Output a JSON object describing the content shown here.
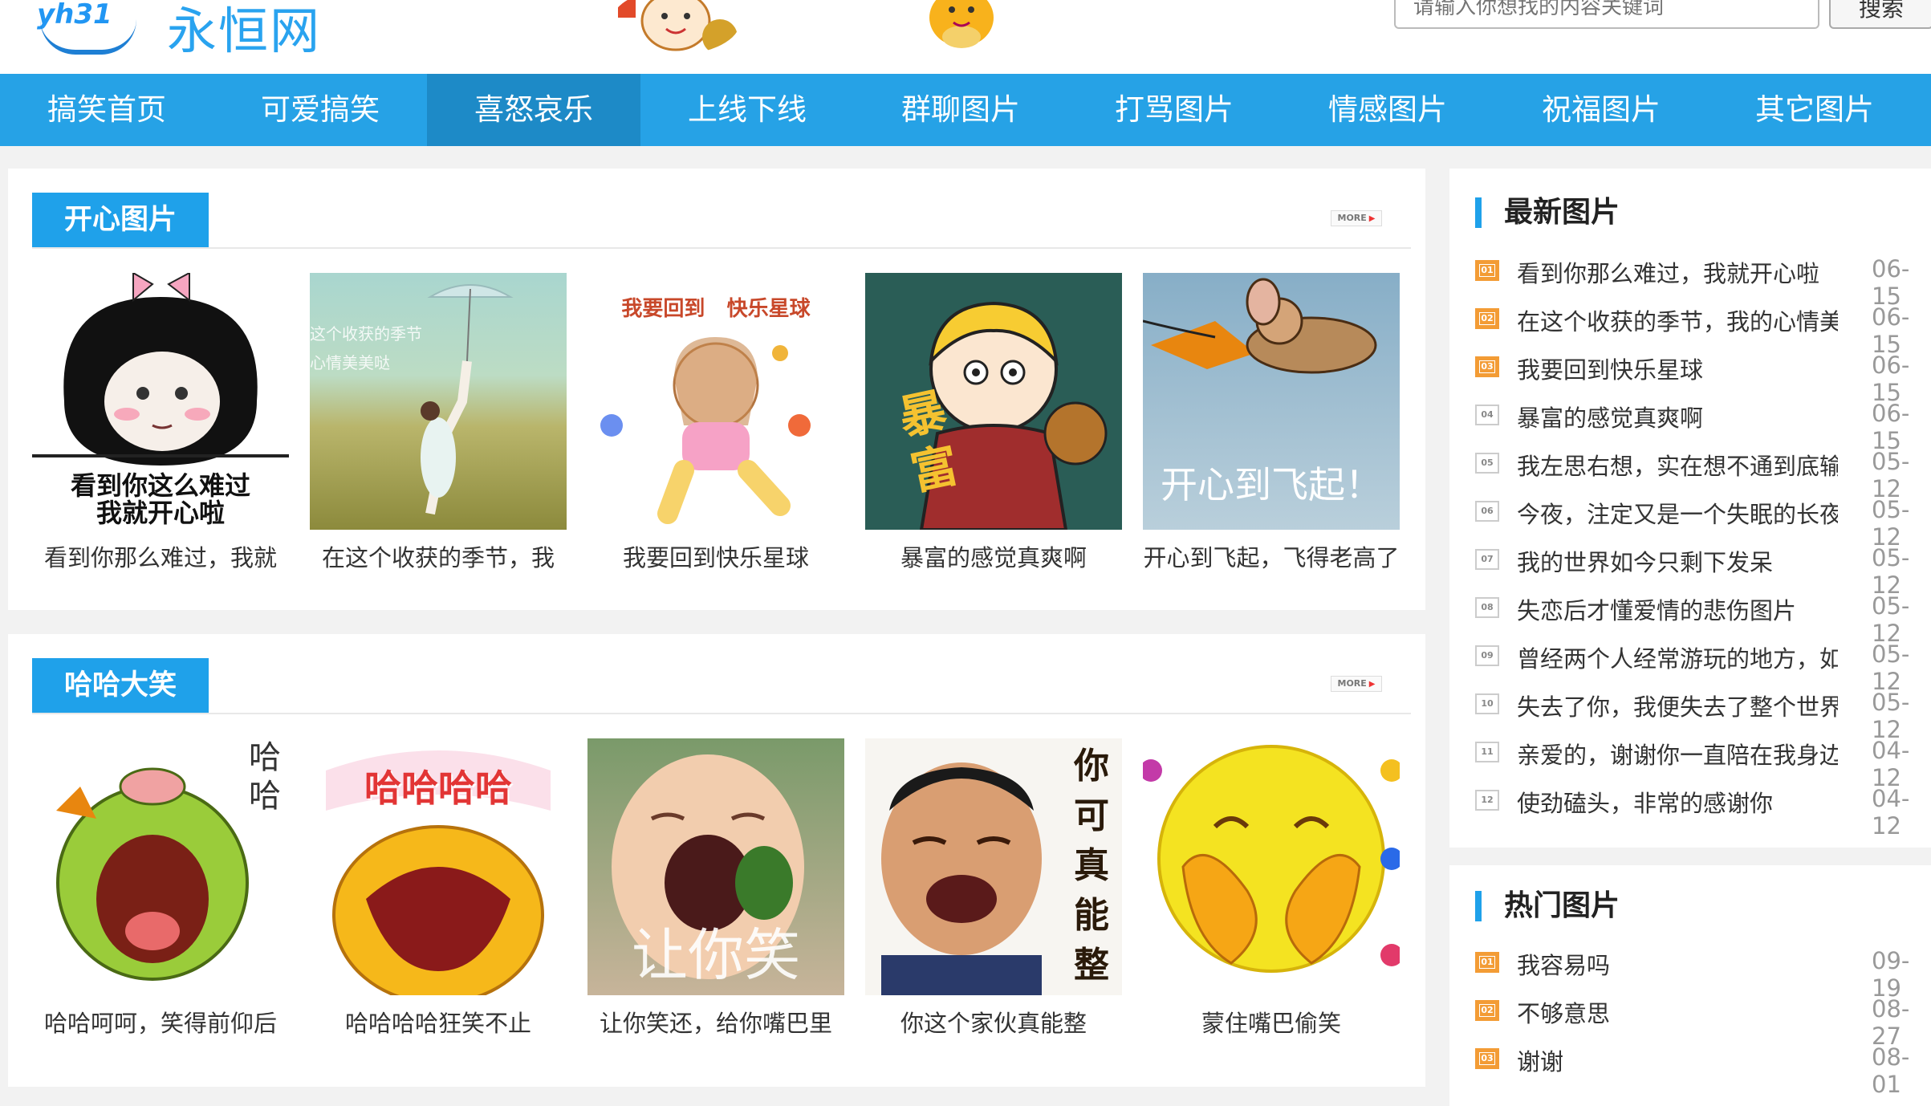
{
  "header": {
    "logo_text": "yh31",
    "logo_cn": "永恒网",
    "search_placeholder": "请输入你想找的内容关键词",
    "search_button": "搜索"
  },
  "nav": [
    "搞笑首页",
    "可爱搞笑",
    "喜怒哀乐",
    "上线下线",
    "群聊图片",
    "打骂图片",
    "情感图片",
    "祝福图片",
    "其它图片"
  ],
  "sections": [
    {
      "title": "开心图片",
      "more": "MORE",
      "items": [
        {
          "caption": "看到你那么难过，我就",
          "overlay": "看到你这么难过\n我就开心啦"
        },
        {
          "caption": "在这个收获的季节，我",
          "overlay": "这个收获的季节\n心情美美哒"
        },
        {
          "caption": "我要回到快乐星球",
          "overlay": "我要回到   快乐星球"
        },
        {
          "caption": "暴富的感觉真爽啊",
          "overlay": "暴富"
        },
        {
          "caption": "开心到飞起，飞得老高了",
          "overlay": "开心到飞起！"
        }
      ]
    },
    {
      "title": "哈哈大笑",
      "more": "MORE",
      "items": [
        {
          "caption": "哈哈呵呵，笑得前仰后",
          "overlay": "哈哈"
        },
        {
          "caption": "哈哈哈哈狂笑不止",
          "overlay": "哈哈哈哈"
        },
        {
          "caption": "让你笑还，给你嘴巴里",
          "overlay": "让你笑"
        },
        {
          "caption": "你这个家伙真能整",
          "overlay": "你可真能整"
        },
        {
          "caption": "蒙住嘴巴偷笑",
          "overlay": ""
        }
      ]
    }
  ],
  "sidebar": {
    "latest": {
      "title": "最新图片",
      "items": [
        {
          "rank": "01",
          "title": "看到你那么难过，我就开心啦",
          "date": "06-15"
        },
        {
          "rank": "02",
          "title": "在这个收获的季节，我的心情美",
          "date": "06-15"
        },
        {
          "rank": "03",
          "title": "我要回到快乐星球",
          "date": "06-15"
        },
        {
          "rank": "04",
          "title": "暴富的感觉真爽啊",
          "date": "06-15"
        },
        {
          "rank": "05",
          "title": "我左思右想，实在想不通到底输",
          "date": "05-12"
        },
        {
          "rank": "06",
          "title": "今夜，注定又是一个失眠的长夜",
          "date": "05-12"
        },
        {
          "rank": "07",
          "title": "我的世界如今只剩下发呆",
          "date": "05-12"
        },
        {
          "rank": "08",
          "title": "失恋后才懂爱情的悲伤图片",
          "date": "05-12"
        },
        {
          "rank": "09",
          "title": "曾经两个人经常游玩的地方，如",
          "date": "05-12"
        },
        {
          "rank": "10",
          "title": "失去了你，我便失去了整个世界",
          "date": "05-12"
        },
        {
          "rank": "11",
          "title": "亲爱的，谢谢你一直陪在我身边",
          "date": "04-12"
        },
        {
          "rank": "12",
          "title": "使劲磕头，非常的感谢你",
          "date": "04-12"
        }
      ]
    },
    "hot": {
      "title": "热门图片",
      "items": [
        {
          "rank": "01",
          "title": "我容易吗",
          "date": "09-19"
        },
        {
          "rank": "02",
          "title": "不够意思",
          "date": "08-27"
        },
        {
          "rank": "03",
          "title": "谢谢",
          "date": "08-01"
        }
      ]
    }
  }
}
